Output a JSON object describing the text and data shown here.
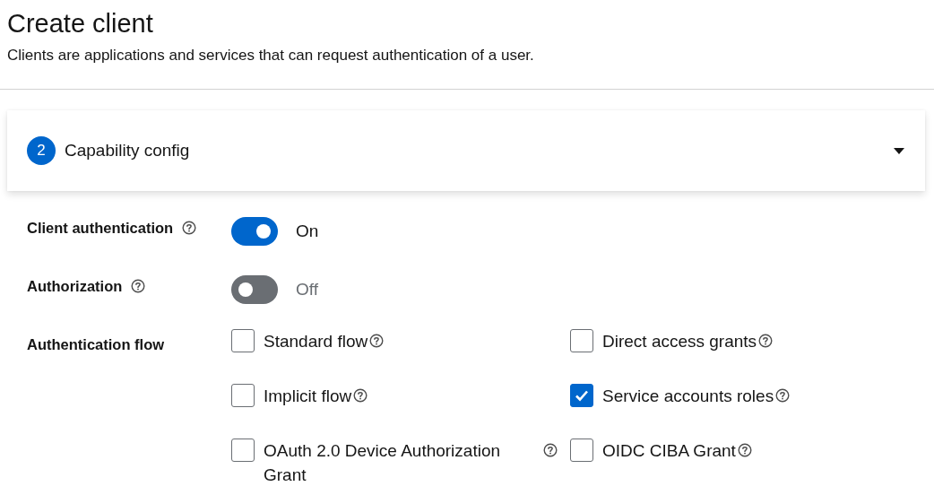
{
  "header": {
    "title": "Create client",
    "description": "Clients are applications and services that can request authentication of a user."
  },
  "step": {
    "number": "2",
    "title": "Capability config",
    "expanded": true
  },
  "fields": [
    {
      "kind": "switch",
      "label": "Client authentication",
      "on": true,
      "state_text": "On"
    },
    {
      "kind": "switch",
      "label": "Authorization",
      "on": false,
      "state_text": "Off"
    },
    {
      "kind": "checkboxes",
      "label": "Authentication flow",
      "options": [
        {
          "label": "Standard flow",
          "checked": false
        },
        {
          "label": "Direct access grants",
          "checked": false
        },
        {
          "label": "Implicit flow",
          "checked": false
        },
        {
          "label": "Service accounts roles",
          "checked": true
        },
        {
          "label": "OAuth 2.0 Device Authorization Grant",
          "checked": false
        },
        {
          "label": "OIDC CIBA Grant",
          "checked": false
        }
      ]
    }
  ]
}
